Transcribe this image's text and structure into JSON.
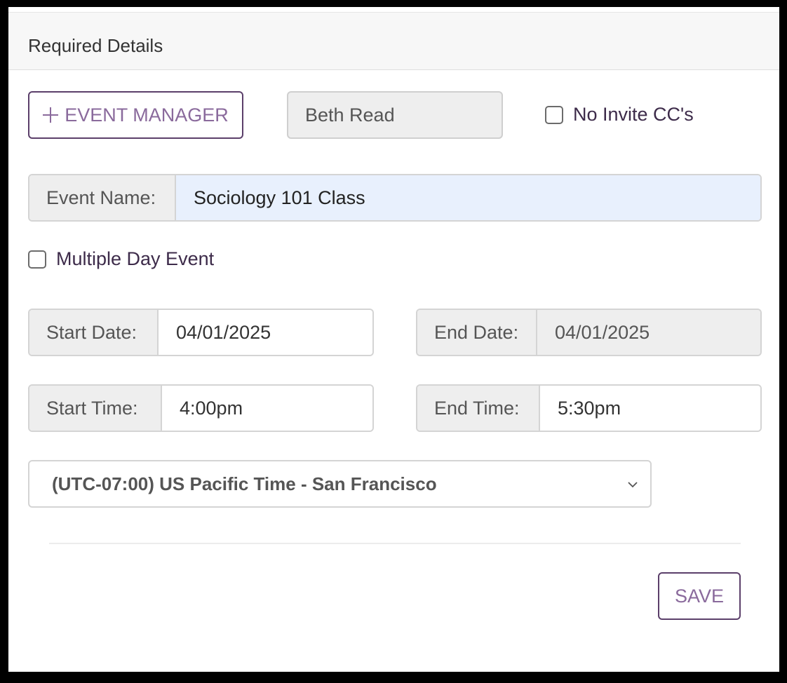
{
  "header": {
    "title": "Required Details"
  },
  "event_manager_button": {
    "label": "EVENT MANAGER"
  },
  "manager_name": "Beth Read",
  "no_invite_cc": {
    "label": "No Invite CC's",
    "checked": false
  },
  "event_name": {
    "label": "Event Name:",
    "value": "Sociology 101 Class"
  },
  "multiple_day": {
    "label": "Multiple Day Event",
    "checked": false
  },
  "start_date": {
    "label": "Start Date:",
    "value": "04/01/2025"
  },
  "end_date": {
    "label": "End Date:",
    "value": "04/01/2025"
  },
  "start_time": {
    "label": "Start Time:",
    "value": "4:00pm"
  },
  "end_time": {
    "label": "End Time:",
    "value": "5:30pm"
  },
  "timezone": {
    "selected": "(UTC-07:00) US Pacific Time - San Francisco"
  },
  "save_button": {
    "label": "SAVE"
  },
  "colors": {
    "accent": "#5b3f6a",
    "accent_text": "#8a6a9c",
    "highlight_field": "#e8f0fd",
    "addon_bg": "#eeeeee"
  }
}
